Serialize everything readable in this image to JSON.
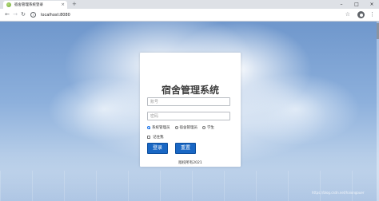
{
  "browser": {
    "tab_title": "宿舍管理系统登录",
    "tab_close": "×",
    "new_tab": "+",
    "url": "localhost:8080",
    "info": "i",
    "window_controls": {
      "minimize": "–",
      "maximize": "□",
      "close": "×"
    },
    "nav": {
      "back": "←",
      "forward": "→",
      "reload": "↻"
    },
    "star": "☆",
    "menu": "⋮"
  },
  "login": {
    "title": "宿舍管理系统",
    "username_placeholder": "账号",
    "password_placeholder": "密码",
    "roles": [
      {
        "label": "系统管理员",
        "checked": true
      },
      {
        "label": "宿舍管理员",
        "checked": false
      },
      {
        "label": "学生",
        "checked": false
      }
    ],
    "remember_label": "记住我",
    "login_button": "登录",
    "reset_button": "重置",
    "copyright": "版权所有2021"
  },
  "watermark": "https://blog.csdn.net/haiongouer"
}
